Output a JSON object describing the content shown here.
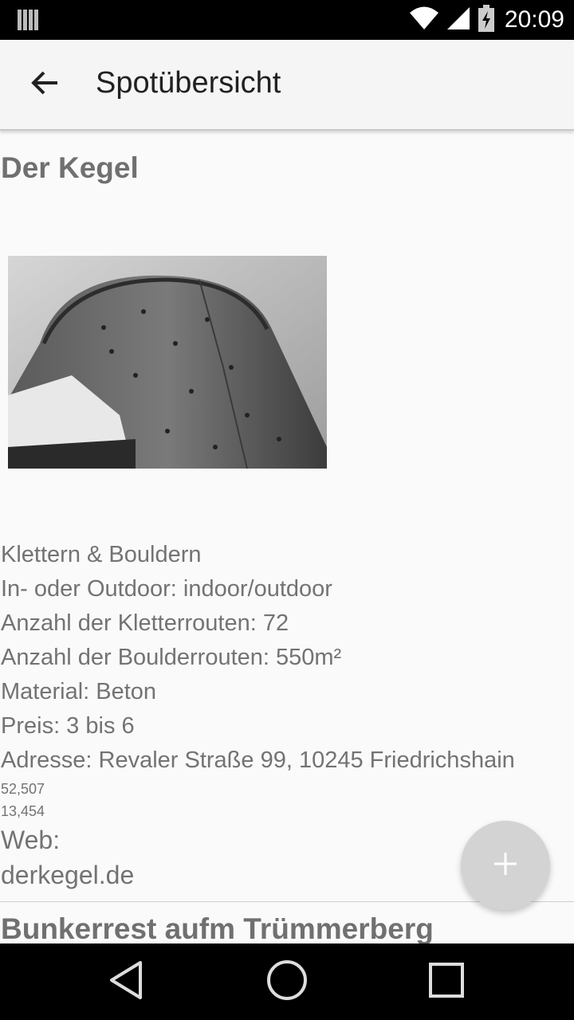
{
  "status_bar": {
    "time": "20:09",
    "icons": [
      "notification-bars-icon",
      "wifi-icon",
      "signal-icon",
      "battery-charging-icon"
    ]
  },
  "app_bar": {
    "title": "Spotübersicht",
    "back_icon": "arrow-back-icon"
  },
  "spot": {
    "name": "Der Kegel",
    "photo": "climbing-tower-photo",
    "details": [
      "Klettern & Bouldern",
      "In- oder Outdoor: indoor/outdoor",
      "Anzahl der Kletterrouten: 72",
      "Anzahl der Boulderrouten: 550m²",
      "Material: Beton",
      "Preis: 3 bis 6",
      "Adresse: Revaler Straße 99, 10245 Friedrichshain"
    ],
    "latitude": "52,507",
    "longitude": "13,454",
    "web_label": "Web:",
    "web_url": "derkegel.de"
  },
  "next_spot": {
    "name": "Bunkerrest aufm Trümmerberg"
  },
  "fab": {
    "icon": "plus-icon"
  },
  "nav_bar": {
    "icons": [
      "back-triangle-icon",
      "home-circle-icon",
      "recents-square-icon"
    ]
  }
}
